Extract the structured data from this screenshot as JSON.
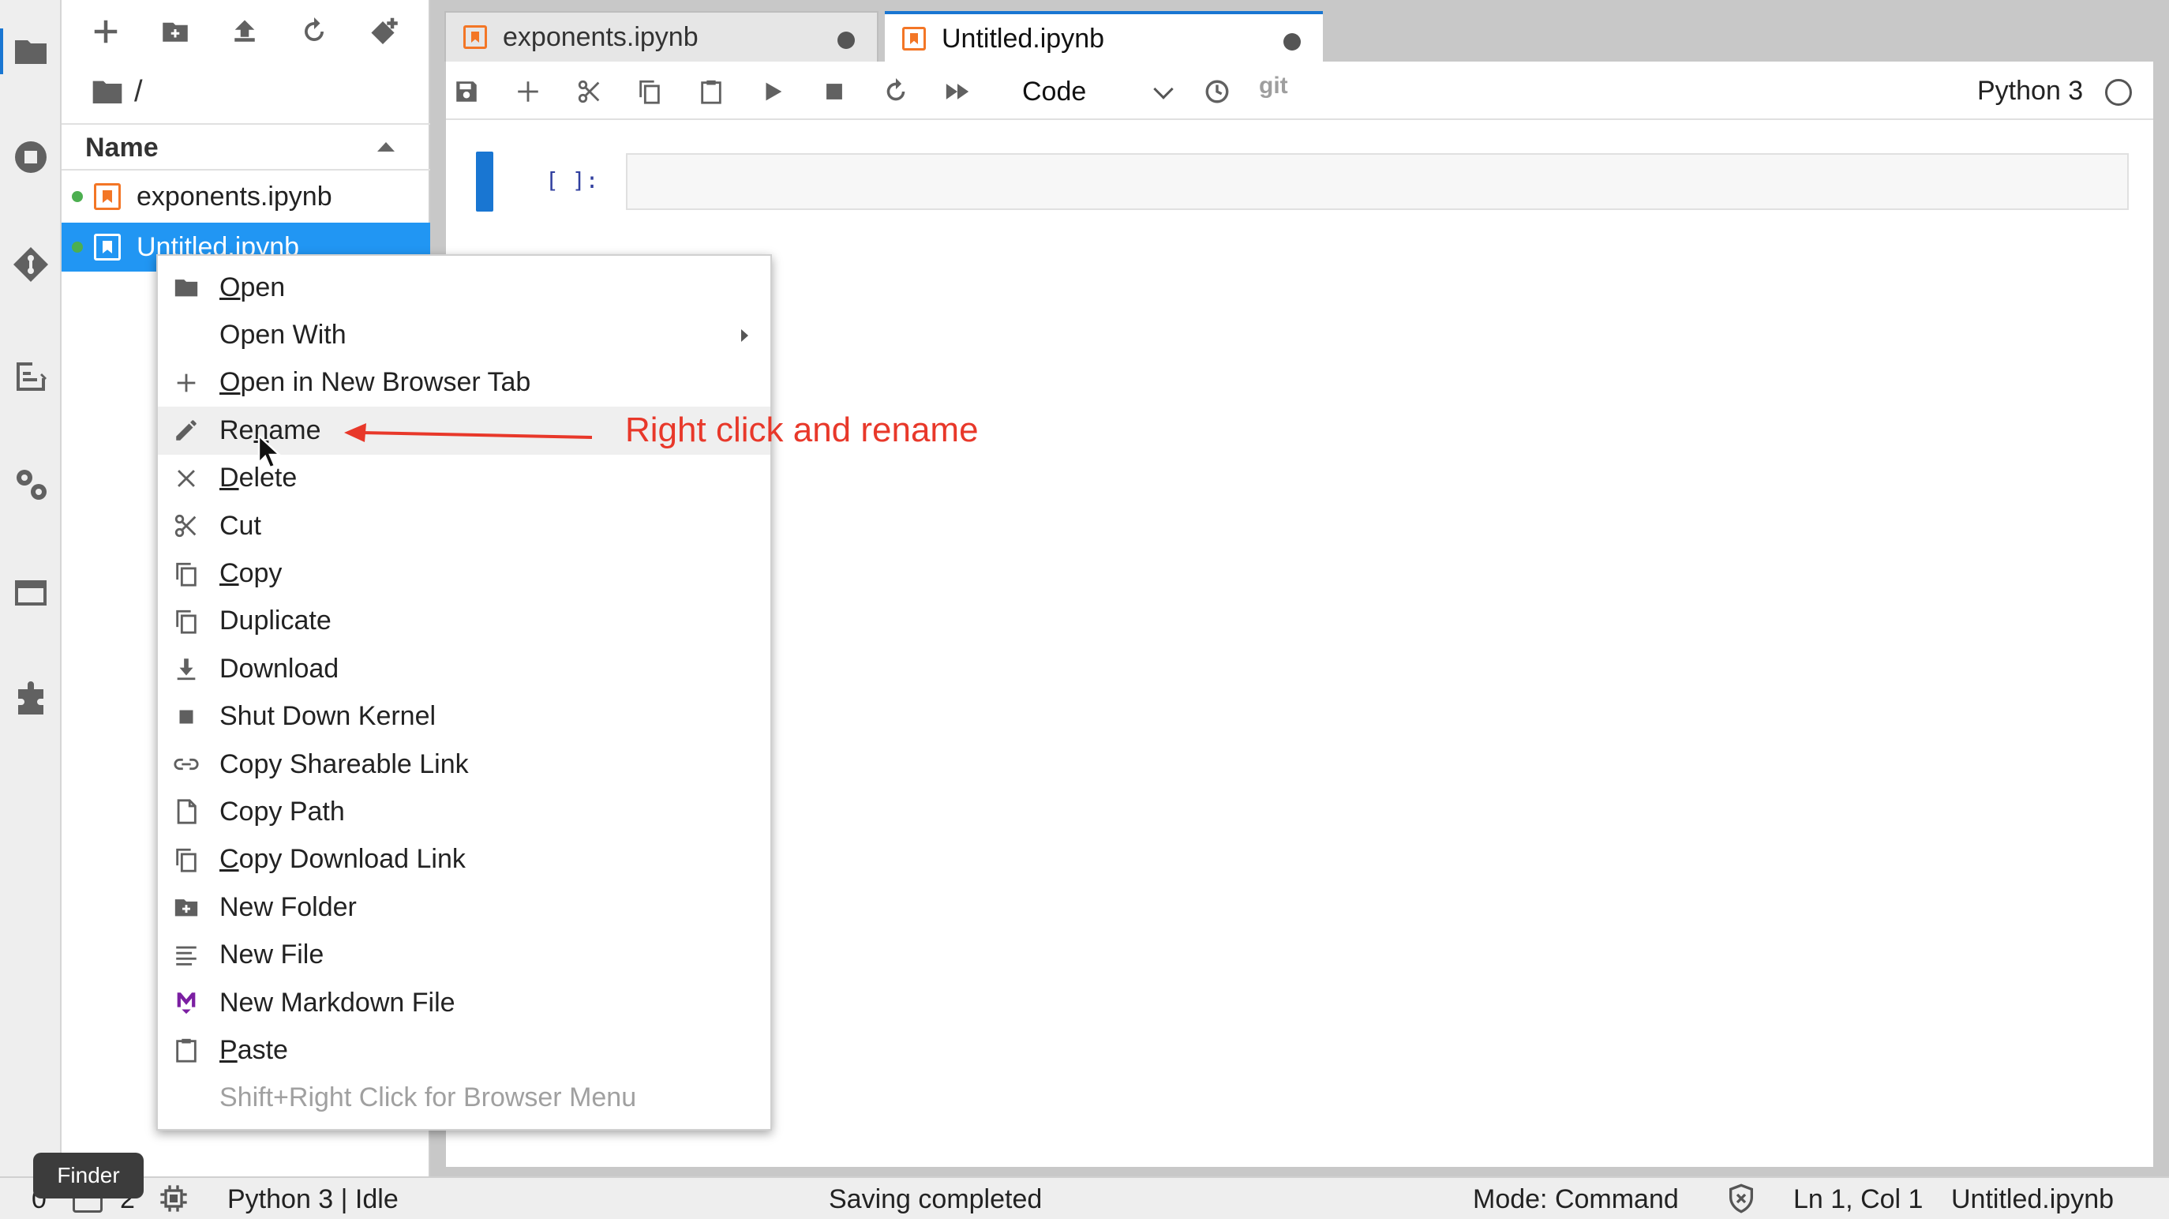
{
  "activity_bar": {
    "icons": [
      "folder-icon",
      "running-icon",
      "git-icon",
      "property-inspector-icon",
      "gears-icon",
      "tabs-icon",
      "extension-icon"
    ]
  },
  "file_browser": {
    "toolbar": [
      "new-launcher-icon",
      "new-folder-icon",
      "upload-icon",
      "refresh-icon",
      "git-clone-icon"
    ],
    "breadcrumb": "/",
    "column_name": "Name",
    "files": [
      {
        "name": "exponents.ipynb",
        "running": true,
        "selected": false
      },
      {
        "name": "Untitled.ipynb",
        "running": true,
        "selected": true
      }
    ]
  },
  "tabs": [
    {
      "label": "exponents.ipynb",
      "active": false
    },
    {
      "label": "Untitled.ipynb",
      "active": true
    }
  ],
  "notebook_toolbar": {
    "cell_type": "Code",
    "git_label": "git",
    "kernel_name": "Python 3"
  },
  "cell": {
    "prompt": "[ ]:"
  },
  "context_menu": {
    "items": [
      {
        "label": "Open",
        "mnemonic": "O",
        "icon": "folder-icon"
      },
      {
        "label": "Open With",
        "submenu": true
      },
      {
        "label": "Open in New Browser Tab",
        "mnemonic": "O",
        "icon": "add-icon"
      },
      {
        "label": "Rename",
        "mnemonic": "n",
        "icon": "edit-icon",
        "highlight": true
      },
      {
        "label": "Delete",
        "mnemonic": "D",
        "icon": "close-icon"
      },
      {
        "label": "Cut",
        "icon": "cut-icon"
      },
      {
        "label": "Copy",
        "mnemonic": "C",
        "icon": "copy-icon"
      },
      {
        "label": "Duplicate",
        "icon": "copy-icon"
      },
      {
        "label": "Download",
        "icon": "download-icon"
      },
      {
        "label": "Shut Down Kernel",
        "icon": "stop-icon"
      },
      {
        "label": "Copy Shareable Link",
        "icon": "link-icon"
      },
      {
        "label": "Copy Path",
        "icon": "file-icon"
      },
      {
        "label": "Copy Download Link",
        "mnemonic": "C",
        "icon": "copy-icon"
      },
      {
        "label": "New Folder",
        "icon": "new-folder-icon"
      },
      {
        "label": "New File",
        "icon": "text-file-icon"
      },
      {
        "label": "New Markdown File",
        "icon": "markdown-icon"
      },
      {
        "label": "Paste",
        "mnemonic": "P",
        "icon": "paste-icon"
      },
      {
        "label": "Shift+Right Click for Browser Menu",
        "disabled": true
      }
    ]
  },
  "annotation": {
    "text": "Right click and rename",
    "color": "#e8382a"
  },
  "statusbar": {
    "terminals": "0",
    "kernels": "2",
    "kernel_state": "Python 3 | Idle",
    "save_status": "Saving completed",
    "mode": "Mode: Command",
    "cursor_position": "Ln 1, Col 1",
    "active_file": "Untitled.ipynb",
    "tooltip": "Finder"
  },
  "colors": {
    "accent": "#1976d2",
    "selection": "#2196f3",
    "notebook_orange": "#f37626",
    "running_dot": "#4caf50"
  }
}
